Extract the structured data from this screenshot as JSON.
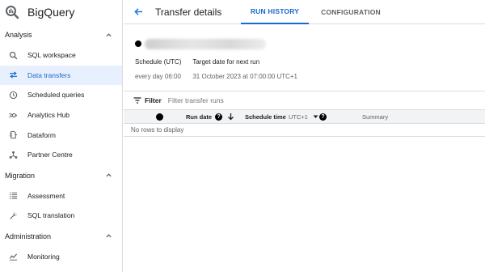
{
  "app": {
    "name": "BigQuery"
  },
  "sidebar": {
    "sections": [
      {
        "title": "Analysis",
        "items": [
          {
            "label": "SQL workspace",
            "icon": "search-icon",
            "active": false
          },
          {
            "label": "Data transfers",
            "icon": "transfer-icon",
            "active": true
          },
          {
            "label": "Scheduled queries",
            "icon": "clock-icon",
            "active": false
          },
          {
            "label": "Analytics Hub",
            "icon": "hub-icon",
            "active": false
          },
          {
            "label": "Dataform",
            "icon": "dataform-icon",
            "active": false
          },
          {
            "label": "Partner Centre",
            "icon": "partner-icon",
            "active": false
          }
        ]
      },
      {
        "title": "Migration",
        "items": [
          {
            "label": "Assessment",
            "icon": "assessment-icon",
            "active": false
          },
          {
            "label": "SQL translation",
            "icon": "wrench-icon",
            "active": false
          }
        ]
      },
      {
        "title": "Administration",
        "items": [
          {
            "label": "Monitoring",
            "icon": "monitoring-icon",
            "active": false
          }
        ]
      }
    ]
  },
  "header": {
    "title": "Transfer details",
    "tabs": [
      {
        "label": "RUN HISTORY",
        "active": true
      },
      {
        "label": "CONFIGURATION",
        "active": false
      }
    ]
  },
  "details": {
    "schedule_label": "Schedule (UTC)",
    "schedule_value": "every day 06:00",
    "target_label": "Target date for next run",
    "target_value": "31 October 2023 at 07:00:00 UTC+1"
  },
  "filter": {
    "label": "Filter",
    "placeholder": "Filter transfer runs"
  },
  "table": {
    "columns": {
      "run_date": "Run date",
      "schedule_time": "Schedule time",
      "timezone": "UTC+1",
      "summary": "Summary"
    },
    "empty_text": "No rows to display"
  },
  "colors": {
    "accent": "#1967d2",
    "active_bg": "#e8f0fe"
  }
}
